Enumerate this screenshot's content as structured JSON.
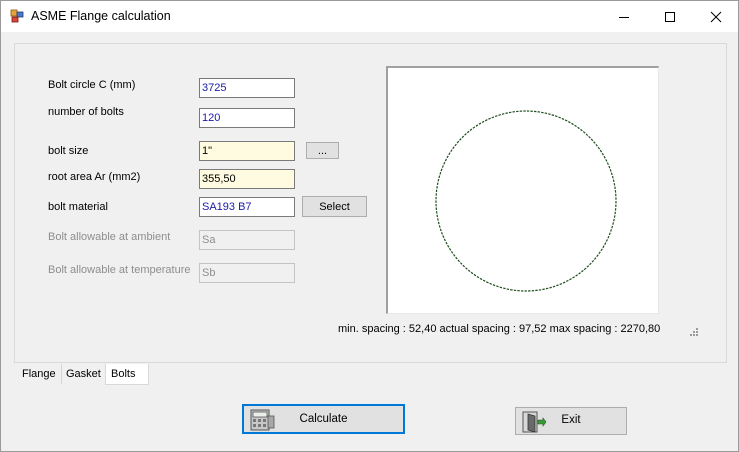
{
  "window": {
    "title": "ASME Flange calculation",
    "minimize_icon": "minimize-icon",
    "maximize_icon": "maximize-icon",
    "close_icon": "close-icon"
  },
  "form": {
    "bolt_circle": {
      "label": "Bolt circle C (mm)",
      "value": "3725"
    },
    "number_of_bolts": {
      "label": "number of bolts",
      "value": "120"
    },
    "bolt_size": {
      "label": "bolt size",
      "value": "1\"",
      "button_label": "..."
    },
    "root_area": {
      "label": "root area Ar (mm2)",
      "value": "355,50"
    },
    "bolt_material": {
      "label": "bolt material",
      "value": "SA193 B7",
      "button_label": "Select"
    },
    "allowable_ambient": {
      "label": "Bolt allowable at ambient",
      "placeholder": "Sa"
    },
    "allowable_temperature": {
      "label": "Bolt allowable at temperature",
      "placeholder": "Sb"
    }
  },
  "preview": {
    "circle_color": "#1f4d1f"
  },
  "status": {
    "text": "min. spacing : 52,40  actual spacing : 97,52  max spacing : 2270,80"
  },
  "tabs": [
    {
      "label": "Flange"
    },
    {
      "label": "Gasket"
    },
    {
      "label": "Bolts",
      "active": true
    }
  ],
  "actions": {
    "calculate_label": "Calculate",
    "exit_label": "Exit"
  },
  "colors": {
    "accent": "#0078d7",
    "value_text": "#1a1aa6",
    "highlight_field": "#fffbe0"
  }
}
